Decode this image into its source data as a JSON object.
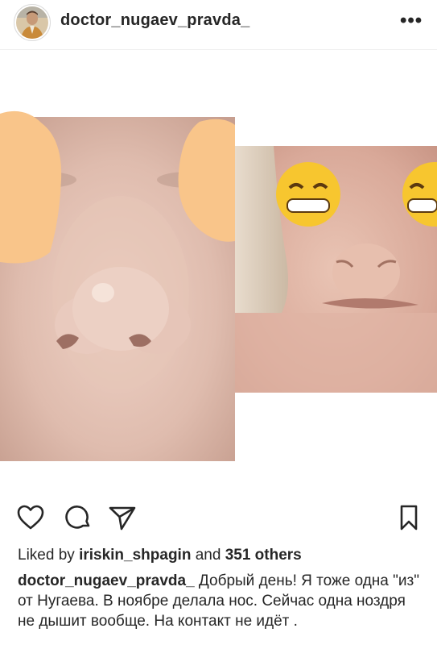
{
  "post": {
    "username": "doctor_nugaev_pravda_",
    "more_label": "•••",
    "likes": {
      "prefix": "Liked by",
      "user": "iriskin_shpagin",
      "middle": "and",
      "others": "351 others"
    },
    "caption": {
      "username": "doctor_nugaev_pravda_",
      "text": "Добрый день! Я тоже одна \"из\" от Нугаева. В ноябре делала нос. Сейчас одна ноздря не дышит вообще. На контакт не идёт ."
    }
  },
  "icons": {
    "like": "heart-icon",
    "comment": "comment-icon",
    "share": "paper-plane-icon",
    "save": "bookmark-icon",
    "more": "more-dots-icon"
  },
  "colors": {
    "text": "#262626",
    "skin": "#e2c0b4",
    "blur_patch": "#f9c58a",
    "emoji": "#f7c62f"
  }
}
